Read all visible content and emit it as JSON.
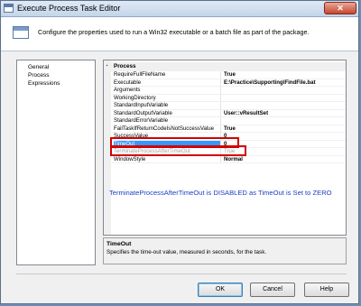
{
  "window": {
    "title": "Execute Process Task Editor",
    "close_glyph": "✕"
  },
  "header": {
    "description": "Configure the properties used to run a Win32 executable or a batch file as part of the package."
  },
  "nav": {
    "items": [
      "General",
      "Process",
      "Expressions"
    ]
  },
  "grid": {
    "category": {
      "toggle": "▪",
      "label": "Process"
    },
    "rows": [
      {
        "name": "RequireFullFileName",
        "value": "True"
      },
      {
        "name": "Executable",
        "value": "E:\\Practice\\Supporting\\FindFile.bat"
      },
      {
        "name": "Arguments",
        "value": ""
      },
      {
        "name": "WorkingDirectory",
        "value": ""
      },
      {
        "name": "StandardInputVariable",
        "value": ""
      },
      {
        "name": "StandardOutputVariable",
        "value": "User::vResultSet"
      },
      {
        "name": "StandardErrorVariable",
        "value": ""
      },
      {
        "name": "FailTaskIfReturnCodeIsNotSuccessValue",
        "value": "True"
      },
      {
        "name": "SuccessValue",
        "value": "0"
      },
      {
        "name": "TimeOut",
        "value": "0",
        "selected": true
      },
      {
        "name": "TerminateProcessAfterTimeOut",
        "value": "True",
        "disabled": true
      },
      {
        "name": "WindowStyle",
        "value": "Normal"
      }
    ],
    "note": "TerminateProcessAfterTimeOut is DISABLED as TimeOut is Set to ZERO"
  },
  "description_panel": {
    "title": "TimeOut",
    "text": "Specifies the time-out value, measured in seconds, for the task."
  },
  "buttons": {
    "ok": "OK",
    "cancel": "Cancel",
    "help": "Help"
  },
  "colors": {
    "selection": "#3399ff",
    "highlight_box": "#d40000",
    "note_text": "#1a3fc4",
    "disabled_text": "#a3a3a3"
  }
}
